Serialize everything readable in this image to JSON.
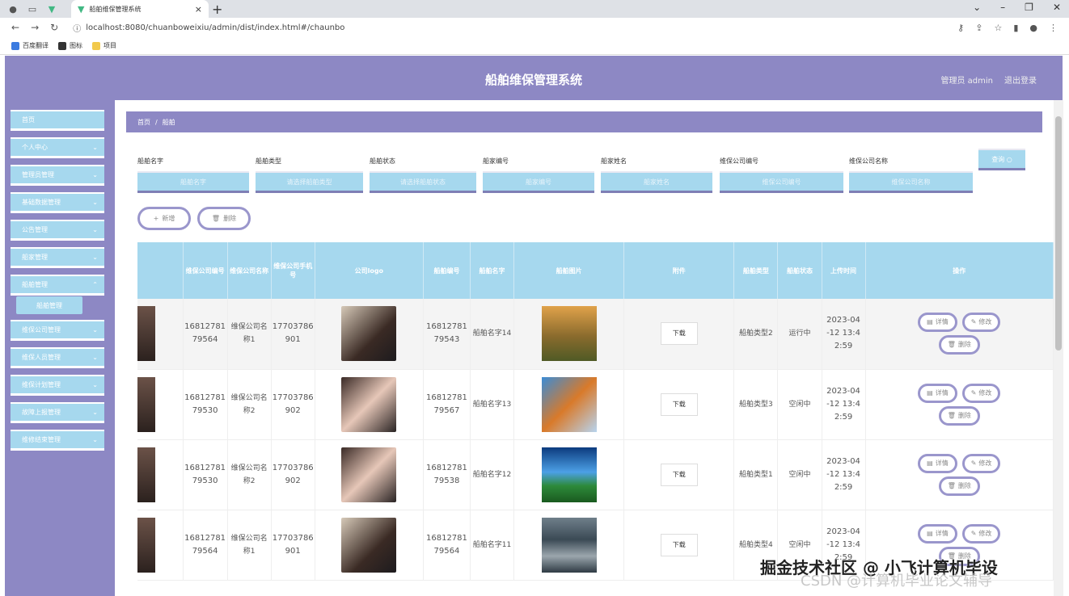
{
  "browser": {
    "tab_title": "船舶维保管理系统",
    "url": "localhost:8080/chuanboweixiu/admin/dist/index.html#/chaunbo",
    "bookmarks": [
      "百度翻译",
      "图标",
      "项目"
    ]
  },
  "header": {
    "title": "船舶维保管理系统",
    "user": "管理员 admin",
    "logout": "退出登录"
  },
  "sidebar": {
    "items": [
      "首页",
      "个人中心",
      "管理员管理",
      "基础数据管理",
      "公告管理",
      "船家管理",
      "船舶管理",
      "维保公司管理",
      "维保人员管理",
      "维保计划管理",
      "故障上报管理",
      "维修结束管理"
    ],
    "sub_item": "船舶管理"
  },
  "breadcrumb": {
    "home": "首页",
    "sep": "/",
    "current": "船舶"
  },
  "search": {
    "labels": [
      "船舶名字",
      "船舶类型",
      "船舶状态",
      "船家编号",
      "船家姓名",
      "维保公司编号",
      "维保公司名称"
    ],
    "placeholders": [
      "船舶名字",
      "请选择船舶类型",
      "请选择船舶状态",
      "船家编号",
      "船家姓名",
      "维保公司编号",
      "维保公司名称"
    ],
    "query_btn": "查询"
  },
  "actions": {
    "add": "新增",
    "delete": "删除"
  },
  "table": {
    "headers": [
      "维保公司编号",
      "维保公司名称",
      "维保公司手机号",
      "公司logo",
      "船舶编号",
      "船舶名字",
      "船舶图片",
      "附件",
      "船舶类型",
      "船舶状态",
      "上传时间",
      "操作"
    ],
    "download": "下载",
    "btn_detail": "详情",
    "btn_edit": "修改",
    "btn_delete": "删除",
    "rows": [
      {
        "company_no": "1681278179564",
        "company_name": "维保公司名称1",
        "phone": "17703786901",
        "ship_no": "1681278179543",
        "ship_name": "船舶名字14",
        "ship_type": "船舶类型2",
        "status": "运行中",
        "time": "2023-04-12 13:42:59"
      },
      {
        "company_no": "1681278179530",
        "company_name": "维保公司名称2",
        "phone": "17703786902",
        "ship_no": "1681278179567",
        "ship_name": "船舶名字13",
        "ship_type": "船舶类型3",
        "status": "空闲中",
        "time": "2023-04-12 13:42:59"
      },
      {
        "company_no": "1681278179530",
        "company_name": "维保公司名称2",
        "phone": "17703786902",
        "ship_no": "1681278179538",
        "ship_name": "船舶名字12",
        "ship_type": "船舶类型1",
        "status": "空闲中",
        "time": "2023-04-12 13:42:59"
      },
      {
        "company_no": "1681278179564",
        "company_name": "维保公司名称1",
        "phone": "17703786901",
        "ship_no": "1681278179564",
        "ship_name": "船舶名字11",
        "ship_type": "船舶类型4",
        "status": "空闲中",
        "time": "2023-04-12 13:42:59"
      }
    ]
  },
  "watermark": {
    "line1": "掘金技术社区 @ 小飞计算机毕设",
    "line2": "CSDN @计算机毕业论文辅导"
  }
}
